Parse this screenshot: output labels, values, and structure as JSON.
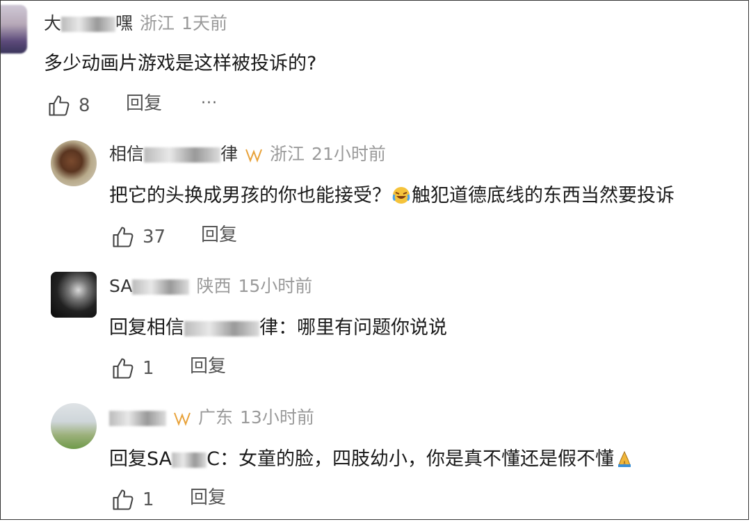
{
  "comments": [
    {
      "user_visible_start": "大",
      "user_visible_end": "嘿",
      "location": "浙江",
      "time": "1天前",
      "text": "多少动画片游戏是这样被投诉的?",
      "likes": "8",
      "reply_label": "回复",
      "more_label": "···"
    },
    {
      "user_visible_start": "相信",
      "user_visible_end": "律",
      "location": "浙江",
      "time": "21小时前",
      "text_before_emoji": "把它的头换成男孩的你也能接受？",
      "text_after_emoji": "触犯道德底线的东西当然要投诉",
      "emoji": "crying-laughing-emoji",
      "likes": "37",
      "reply_label": "回复"
    },
    {
      "user_visible_start": "SA",
      "location": "陕西",
      "time": "15小时前",
      "reply_prefix": "回复",
      "reply_target_start": "相信",
      "reply_target_end": "律",
      "text": "：哪里有问题你说说",
      "likes": "1",
      "reply_label": "回复"
    },
    {
      "location": "广东",
      "time": "13小时前",
      "reply_prefix": "回复",
      "reply_target_start": "SA",
      "reply_target_end": "C",
      "text": "：女童的脸，四肢幼小，你是真不懂还是假不懂",
      "emoji": "folded-hands-emoji",
      "likes": "1",
      "reply_label": "回复"
    }
  ],
  "colors": {
    "meta_gray": "#9a9a9a",
    "text": "#1a1a1a",
    "vip_gold": "#e8a23a"
  }
}
